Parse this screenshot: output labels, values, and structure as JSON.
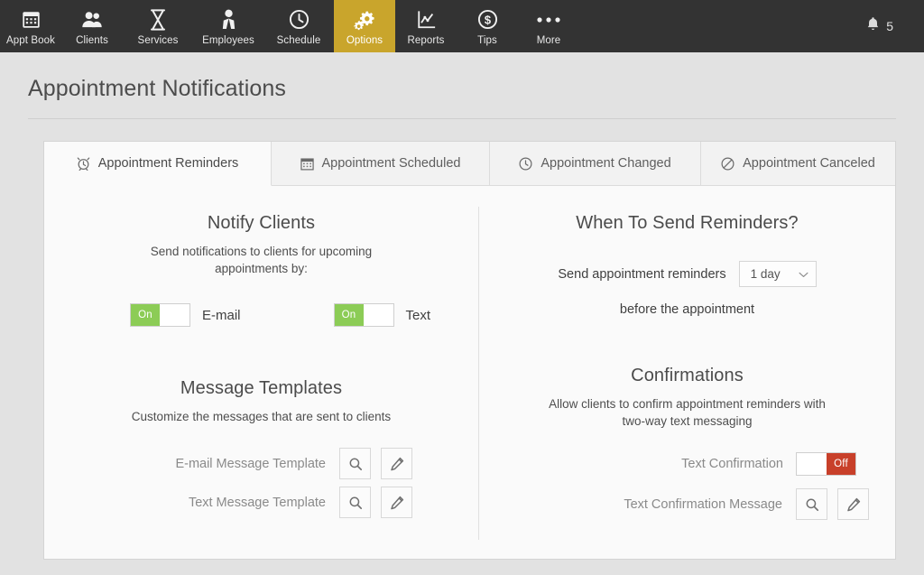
{
  "nav": {
    "items": [
      {
        "label": "Appt Book",
        "icon": "calendar-grid-icon",
        "active": false
      },
      {
        "label": "Clients",
        "icon": "people-icon",
        "active": false
      },
      {
        "label": "Services",
        "icon": "hourglass-icon",
        "active": false
      },
      {
        "label": "Employees",
        "icon": "person-tie-icon",
        "active": false
      },
      {
        "label": "Schedule",
        "icon": "clock-icon",
        "active": false
      },
      {
        "label": "Options",
        "icon": "gears-icon",
        "active": true
      },
      {
        "label": "Reports",
        "icon": "line-chart-icon",
        "active": false
      },
      {
        "label": "Tips",
        "icon": "dollar-circle-icon",
        "active": false
      },
      {
        "label": "More",
        "icon": "ellipsis-icon",
        "active": false
      }
    ],
    "notifications": {
      "icon": "bell-icon",
      "count": "5"
    },
    "active_color": "#c9a52c",
    "bar_color": "#333333"
  },
  "header": {
    "title": "Appointment Notifications"
  },
  "tabs": [
    {
      "label": "Appointment Reminders",
      "icon": "alarm-clock-icon",
      "active": true
    },
    {
      "label": "Appointment Scheduled",
      "icon": "calendar-icon",
      "active": false
    },
    {
      "label": "Appointment Changed",
      "icon": "clock-icon",
      "active": false
    },
    {
      "label": "Appointment Canceled",
      "icon": "ban-icon",
      "active": false
    }
  ],
  "left": {
    "notify": {
      "title": "Notify Clients",
      "subtitle": "Send notifications to clients for upcoming appointments by:",
      "toggles": [
        {
          "label": "E-mail",
          "state": "On",
          "on": true
        },
        {
          "label": "Text",
          "state": "On",
          "on": true
        }
      ]
    },
    "templates": {
      "title": "Message Templates",
      "subtitle": "Customize the messages that are sent to clients",
      "rows": [
        {
          "label": "E-mail Message Template",
          "view": "search-icon",
          "edit": "pencil-icon"
        },
        {
          "label": "Text Message Template",
          "view": "search-icon",
          "edit": "pencil-icon"
        }
      ]
    }
  },
  "right": {
    "when": {
      "title": "When To Send Reminders?",
      "prefix": "Send appointment reminders",
      "selected": "1 day",
      "suffix": "before the appointment",
      "chevron": "chevron-down-icon"
    },
    "confirmations": {
      "title": "Confirmations",
      "subtitle": "Allow clients to confirm appointment reminders with two-way text messaging",
      "toggle": {
        "label": "Text Confirmation",
        "state": "Off",
        "on": false
      },
      "message_row": {
        "label": "Text Confirmation Message",
        "view": "search-icon",
        "edit": "pencil-icon"
      }
    }
  },
  "colors": {
    "on": "#8ccc56",
    "off": "#c8402a",
    "accent": "#c9a52c",
    "page_bg": "#e2e2e2",
    "card_bg": "#fafafa"
  }
}
